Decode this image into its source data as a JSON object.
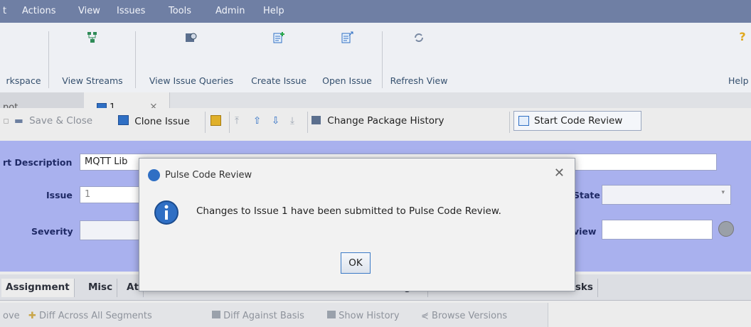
{
  "menubar": {
    "items": [
      "t",
      "Actions",
      "View",
      "Issues",
      "Tools",
      "Admin",
      "Help"
    ]
  },
  "toolbar": {
    "buttons": [
      {
        "label": "rkspace",
        "icon": "workspace-icon"
      },
      {
        "label": "View Streams",
        "icon": "streams-icon"
      },
      {
        "label": "View Issue Queries",
        "icon": "issue-queries-icon"
      },
      {
        "label": "Create Issue",
        "icon": "create-issue-icon"
      },
      {
        "label": "Open Issue",
        "icon": "open-issue-icon"
      },
      {
        "label": "Refresh View",
        "icon": "refresh-icon"
      },
      {
        "label": "Help",
        "icon": "help-icon"
      }
    ]
  },
  "editor_tabs": {
    "inactive_label": "pot",
    "active_label": "1",
    "close_glyph": "⨯"
  },
  "edit_toolbar": {
    "save_close": "Save & Close",
    "clone_issue": "Clone Issue",
    "change_package_history": "Change Package History",
    "start_code_review": "Start Code Review"
  },
  "form": {
    "short_description_label": "rt Description",
    "short_description_value": "MQTT Lib",
    "issue_label": "Issue",
    "issue_value": "1",
    "severity_label": "Severity",
    "state_label": "State",
    "review_label": "view"
  },
  "lower_tabs": [
    "Assignment",
    "Misc",
    "At",
    "Changes",
    "subtasks"
  ],
  "bottom_toolbar": {
    "move": "ove",
    "diff_all": "Diff Across All Segments",
    "diff_basis": "Diff Against Basis",
    "show_history": "Show History",
    "browse_versions": "Browse Versions"
  },
  "dialog": {
    "title": "Pulse Code Review",
    "message": "Changes to Issue 1 have been submitted to Pulse Code Review.",
    "ok_label": "OK"
  },
  "colors": {
    "menubar": "#6f7fa4",
    "form_background": "#a9b1ee",
    "info_icon": "#2f6fc4"
  }
}
